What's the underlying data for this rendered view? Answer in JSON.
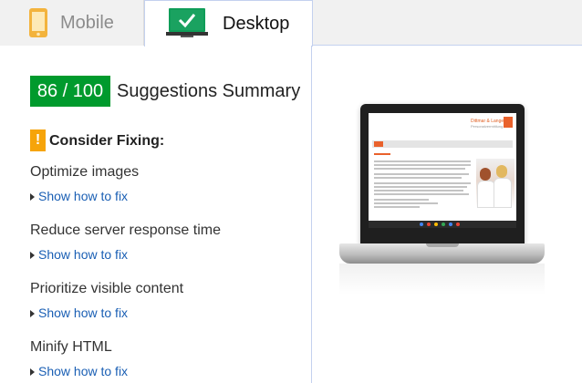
{
  "tabs": {
    "mobile": {
      "label": "Mobile",
      "icon": "smartphone-icon"
    },
    "desktop": {
      "label": "Desktop",
      "icon": "monitor-check-icon",
      "selected": true
    }
  },
  "summary": {
    "score": "86 / 100",
    "title": "Suggestions Summary",
    "score_color": "#009a2d"
  },
  "section": {
    "heading": "Consider Fixing:",
    "icon": "warning-icon",
    "icon_symbol": "!",
    "icon_color": "#f6a40a"
  },
  "rules": [
    {
      "title": "Optimize images",
      "link": "Show how to fix"
    },
    {
      "title": "Reduce server response time",
      "link": "Show how to fix"
    },
    {
      "title": "Prioritize visible content",
      "link": "Show how to fix"
    },
    {
      "title": "Minify HTML",
      "link": "Show how to fix"
    }
  ],
  "preview": {
    "site_logo": "Dittmar & Lange",
    "site_logo_sub": "Personalvermittlung"
  }
}
